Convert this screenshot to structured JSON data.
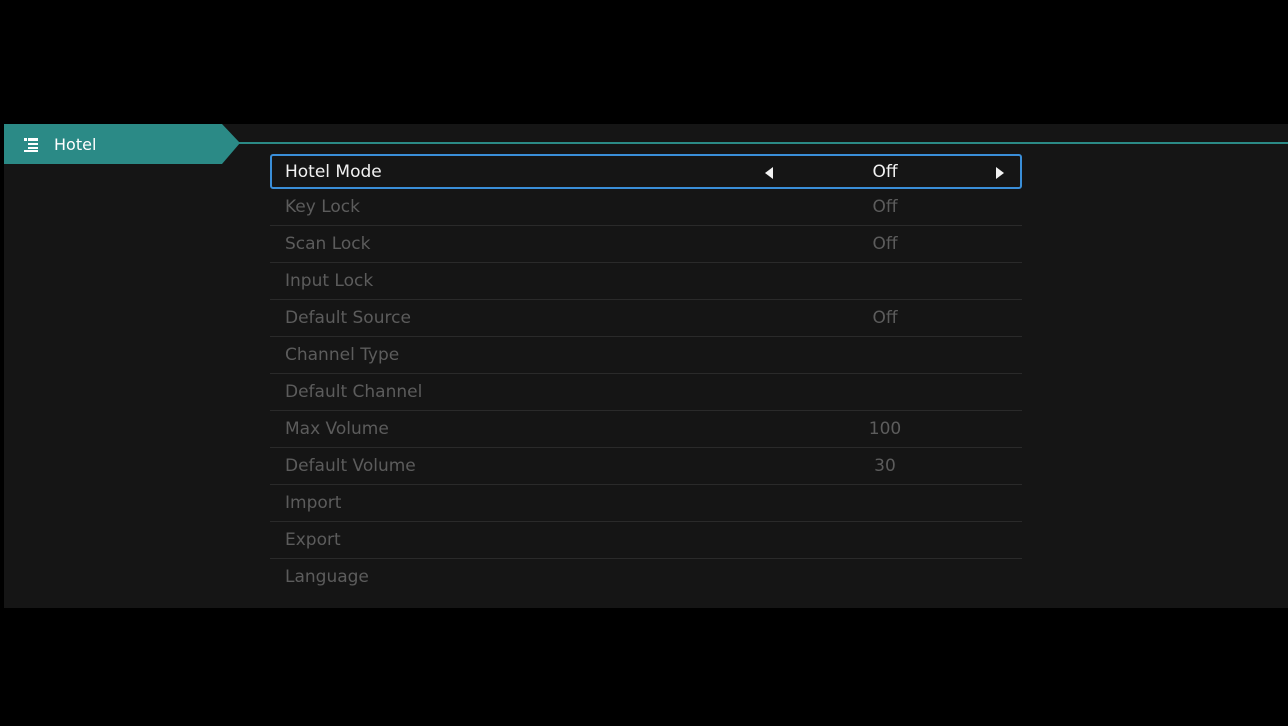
{
  "header": {
    "title": "Hotel",
    "icon": "menu-list-icon"
  },
  "colors": {
    "accent": "#2b8a86",
    "selection_border": "#3a8ed8"
  },
  "menu": {
    "items": [
      {
        "label": "Hotel Mode",
        "value": "Off"
      },
      {
        "label": "Key Lock",
        "value": "Off"
      },
      {
        "label": "Scan Lock",
        "value": "Off"
      },
      {
        "label": "Input Lock",
        "value": ""
      },
      {
        "label": "Default Source",
        "value": "Off"
      },
      {
        "label": "Channel Type",
        "value": ""
      },
      {
        "label": "Default Channel",
        "value": ""
      },
      {
        "label": "Max Volume",
        "value": "100"
      },
      {
        "label": "Default Volume",
        "value": "30"
      },
      {
        "label": "Import",
        "value": ""
      },
      {
        "label": "Export",
        "value": ""
      },
      {
        "label": "Language",
        "value": ""
      }
    ]
  }
}
